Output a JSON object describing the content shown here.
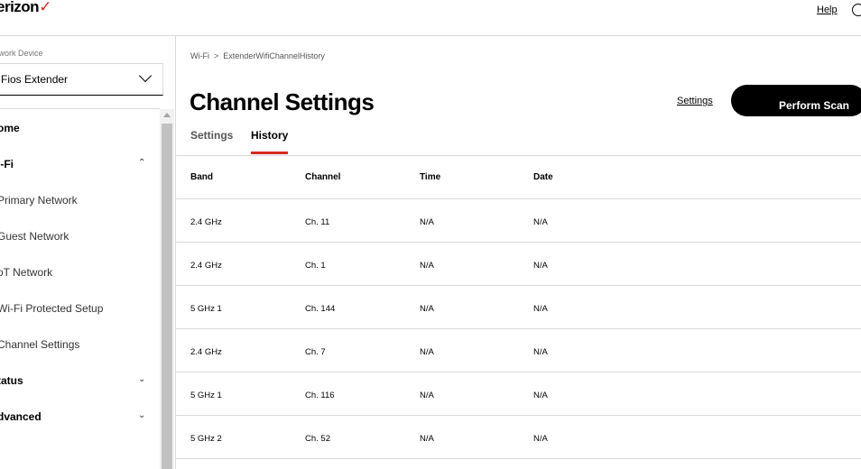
{
  "header": {
    "logo": "erizon",
    "help": "Help"
  },
  "sidebar": {
    "device_label": "twork Device",
    "device_value": "Fios Extender",
    "items": [
      {
        "label": "ome",
        "bold": true
      },
      {
        "label": "i-Fi",
        "bold": true,
        "chevron": "up"
      },
      {
        "label": "Primary Network"
      },
      {
        "label": "Guest Network"
      },
      {
        "label": "oT Network"
      },
      {
        "label": "Wi-Fi Protected Setup"
      },
      {
        "label": "Channel Settings"
      },
      {
        "label": "tatus",
        "bold": true,
        "chevron": "down"
      },
      {
        "label": "dvanced",
        "bold": true,
        "chevron": "down"
      }
    ]
  },
  "breadcrumb": {
    "parent": "Wi-Fi",
    "sep": ">",
    "current": "ExtenderWifiChannelHistory"
  },
  "main": {
    "title": "Channel Settings",
    "settings_link": "Settings",
    "scan_button": "Perform Scan",
    "tabs": [
      {
        "label": "Settings"
      },
      {
        "label": "History"
      }
    ],
    "columns": [
      "Band",
      "Channel",
      "Time",
      "Date"
    ],
    "rows": [
      [
        "2.4 GHz",
        "Ch. 11",
        "N/A",
        "N/A"
      ],
      [
        "2.4 GHz",
        "Ch. 1",
        "N/A",
        "N/A"
      ],
      [
        "5 GHz 1",
        "Ch. 144",
        "N/A",
        "N/A"
      ],
      [
        "2.4 GHz",
        "Ch. 7",
        "N/A",
        "N/A"
      ],
      [
        "5 GHz 1",
        "Ch. 116",
        "N/A",
        "N/A"
      ],
      [
        "5 GHz 2",
        "Ch. 52",
        "N/A",
        "N/A"
      ]
    ]
  },
  "colors": {
    "accent": "#d52b1e"
  }
}
